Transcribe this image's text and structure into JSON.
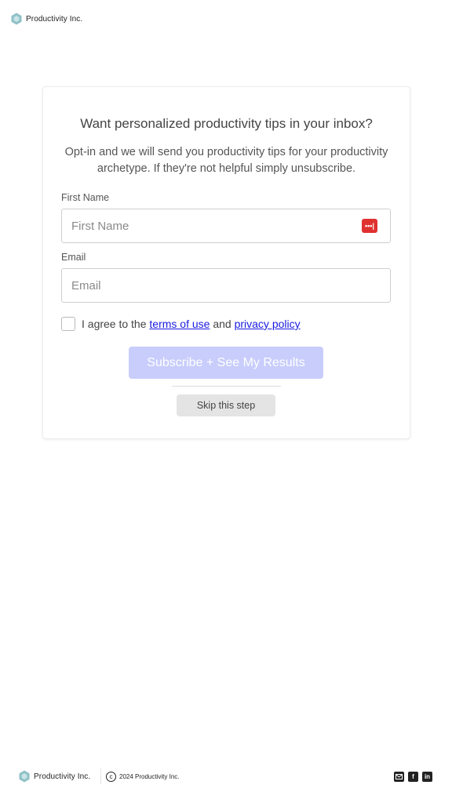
{
  "header": {
    "brand": "Productivity Inc.",
    "logo_icon": "hexagon-logo-icon"
  },
  "card": {
    "headline": "Want personalized productivity tips in your inbox?",
    "subtext": "Opt-in and we will send you productivity tips for your productivity archetype. If they're not helpful simply unsubscribe.",
    "first_name": {
      "label": "First Name",
      "placeholder": "First Name",
      "value": ""
    },
    "email": {
      "label": "Email",
      "placeholder": "Email",
      "value": ""
    },
    "password_manager_icon": "password-manager-icon",
    "agree": {
      "prefix": "I agree to the",
      "terms": "terms of use",
      "middle": "and",
      "privacy": "privacy policy",
      "checked": false
    },
    "subscribe_label": "Subscribe + See My Results",
    "skip_label": "Skip this step"
  },
  "footer": {
    "brand": "Productivity Inc.",
    "copyright_symbol": "c",
    "copyright_text": "2024 Productivity Inc.",
    "social": [
      "email-icon",
      "facebook-icon",
      "linkedin-icon"
    ]
  },
  "colors": {
    "accent_disabled": "#c8cdfc",
    "link": "#1a1ae0",
    "logo": "#8fc1c6",
    "password_manager": "#e03131"
  }
}
